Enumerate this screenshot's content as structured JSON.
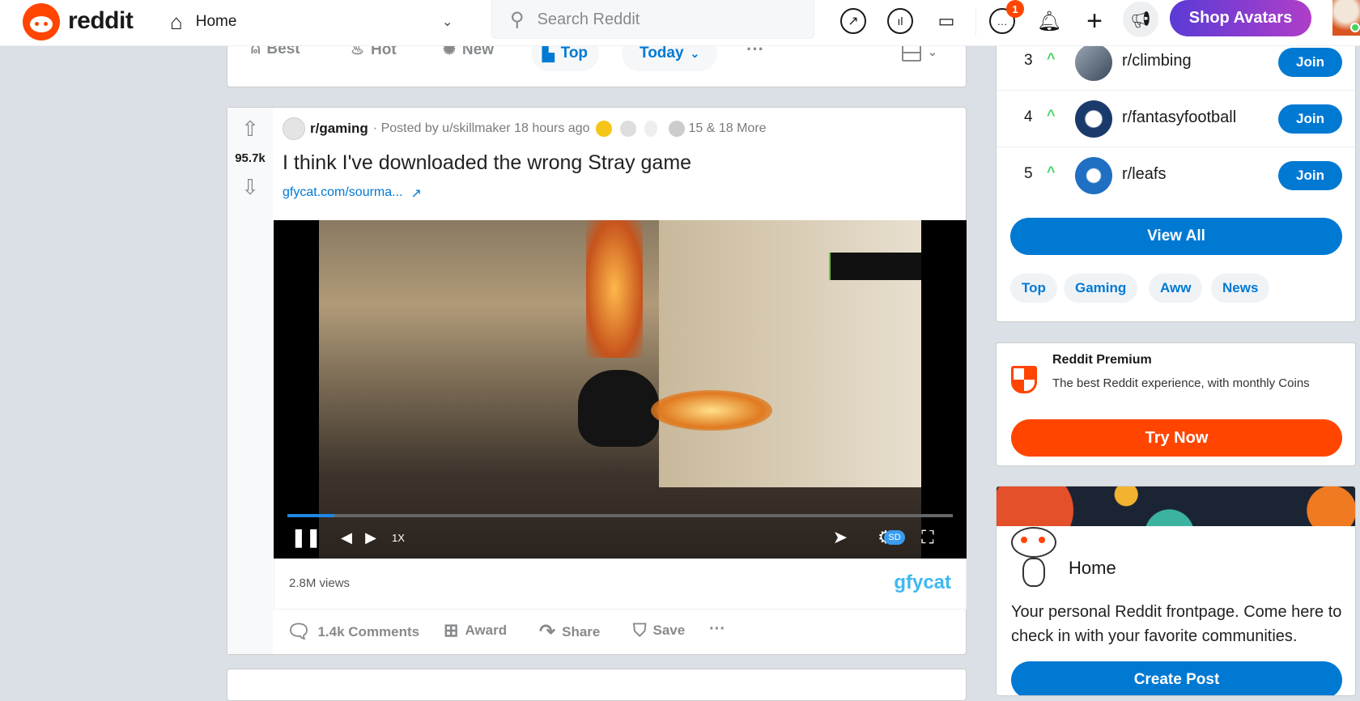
{
  "header": {
    "logo_text": "reddit",
    "feed_label": "Home",
    "search_placeholder": "Search Reddit",
    "notif_count": "1",
    "shop_label": "Shop Avatars"
  },
  "sort": {
    "best": "Best",
    "hot": "Hot",
    "new": "New",
    "top": "Top",
    "range": "Today"
  },
  "post": {
    "subreddit": "r/gaming",
    "meta": "· Posted by u/skillmaker 18 hours ago",
    "awards_more": "15 & 18 More",
    "votes": "95.7k",
    "title": "I think I've downloaded the wrong Stray game",
    "link": "gfycat.com/sourma...",
    "views": "2.8M views",
    "provider": "gfycat",
    "speed": "1X",
    "quality": "SD",
    "progress": 0.07,
    "comments": "1.4k Comments",
    "award": "Award",
    "share": "Share",
    "save": "Save"
  },
  "sidebar": {
    "communities": [
      {
        "rank": "3",
        "name": "r/climbing"
      },
      {
        "rank": "4",
        "name": "r/fantasyfootball"
      },
      {
        "rank": "5",
        "name": "r/leafs"
      }
    ],
    "join": "Join",
    "view_all": "View All",
    "tags": [
      "Top",
      "Gaming",
      "Aww",
      "News"
    ],
    "premium": {
      "title": "Reddit Premium",
      "desc": "The best Reddit experience, with monthly Coins",
      "cta": "Try Now"
    },
    "home": {
      "title": "Home",
      "desc": "Your personal Reddit frontpage. Come here to check in with your favorite communities.",
      "cta": "Create Post"
    }
  },
  "colors": {
    "brand": "#ff4500",
    "blue": "#0079d3"
  }
}
